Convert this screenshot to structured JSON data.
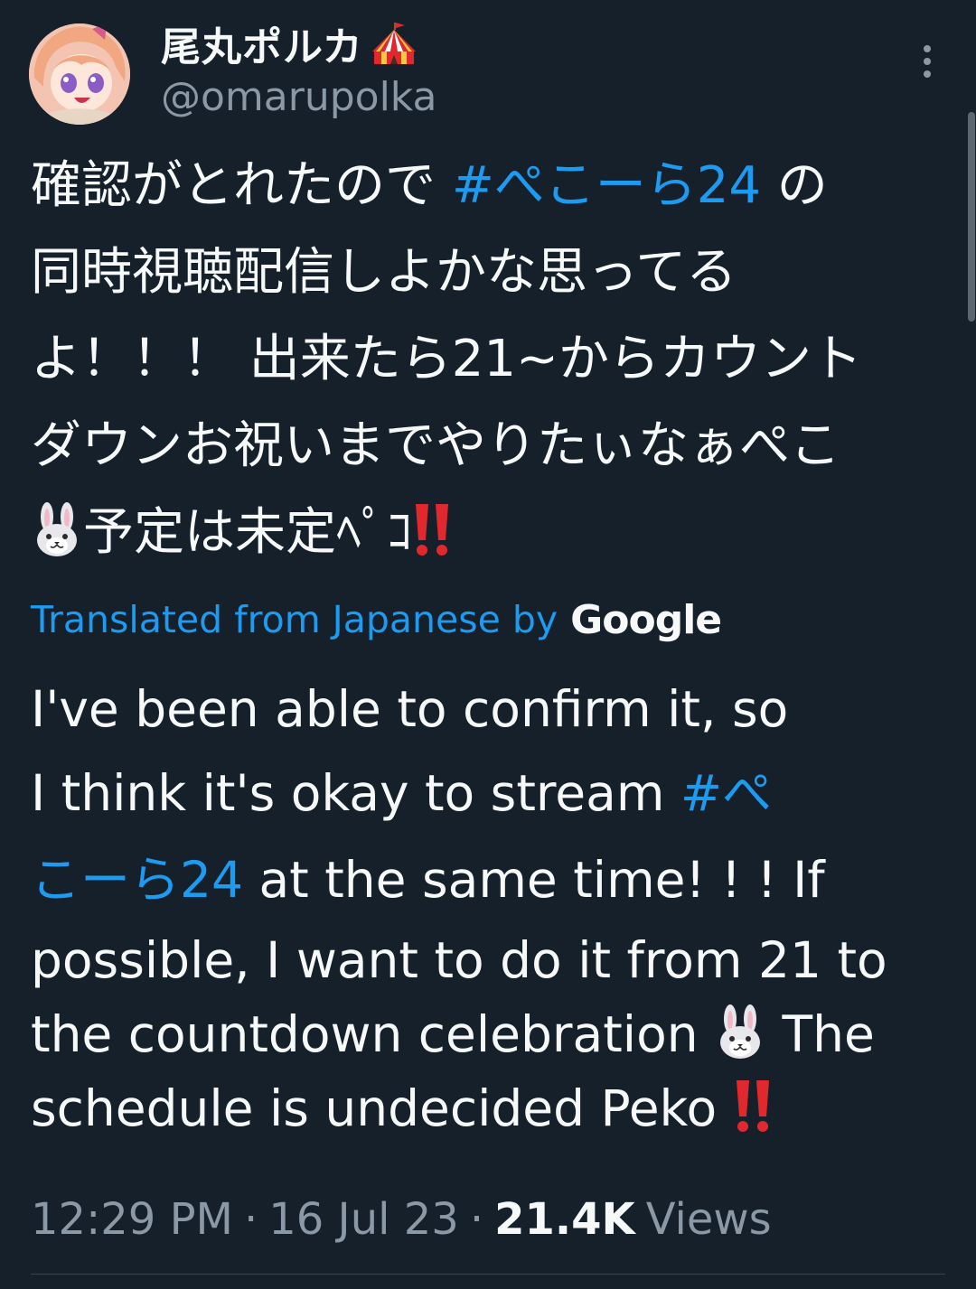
{
  "author": {
    "display_name": "尾丸ポルカ",
    "handle": "@omarupolka",
    "name_emoji": "circus-tent-icon",
    "avatar": "avatar-image"
  },
  "original_text": {
    "line1_text": "確認がとれたので ",
    "line1_hashtag": "#ぺこーら24",
    "line1_tail": " の",
    "line2": "同時視聴配信しよかな思ってる",
    "line3": "よ！！！ 出来たら21~からカウント",
    "line4": "ダウンお祝いまでやりたぃなぁぺこ",
    "line5_text": "予定は未定ﾍﾟｺ"
  },
  "translation_label": {
    "text": "Translated from Japanese by",
    "brand": "Google"
  },
  "translation": {
    "line1": "I've been able to confirm it, so",
    "line2_text": "I think it's okay to stream ",
    "line2_hashtag": "#ぺ",
    "line3_hashtag": "こーら24",
    "line3_text": " at the same time! ! ! If",
    "line4": "possible, I want to do it from 21 to",
    "line5_text": "the countdown celebration ",
    "line5_tail": " The",
    "line6_text": "schedule is undecided Peko "
  },
  "meta": {
    "time": "12:29 PM",
    "separator": "·",
    "date": "16 Jul 23",
    "views_count": "21.4K",
    "views_label": "Views"
  },
  "colors": {
    "background": "#15202b",
    "text": "#f7f9f9",
    "secondary": "#8b98a5",
    "accent": "#1d9bf0",
    "emoji_red": "#e0282e"
  }
}
